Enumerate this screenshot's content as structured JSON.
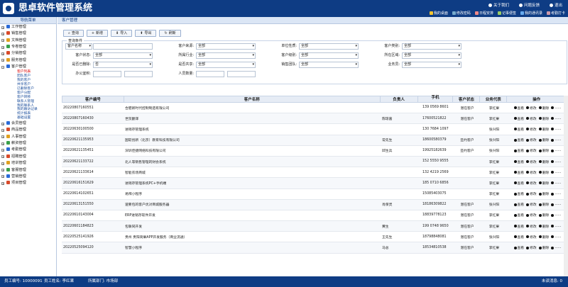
{
  "app": {
    "title": "思卓软件管理系统"
  },
  "sys_menu": [
    "关于我们",
    "问题反馈",
    "退出"
  ],
  "quick_links": [
    "我的桌面",
    "修改密码",
    "日程安排",
    "记事便签",
    "我的通讯录",
    "考勤打卡"
  ],
  "sidebar": {
    "title": "导航菜单",
    "items": [
      {
        "label": "工作管理",
        "color": "#2a6ad8"
      },
      {
        "label": "销售管理",
        "color": "#d84a2a"
      },
      {
        "label": "文档管理",
        "color": "#e0a020"
      },
      {
        "label": "专卷管理",
        "color": "#3aa04a"
      },
      {
        "label": "分销管理",
        "color": "#d84a2a"
      },
      {
        "label": "服务管理",
        "color": "#e0a020"
      },
      {
        "label": "客户管理",
        "color": "#2a6ad8"
      }
    ],
    "sub_items": [
      {
        "label": "客户列表",
        "active": true
      },
      {
        "label": "团队客户"
      },
      {
        "label": "我的客户"
      },
      {
        "label": "共享客户"
      },
      {
        "label": "已删除客户"
      },
      {
        "label": "客户分配"
      },
      {
        "label": "客户转移"
      },
      {
        "label": "联系人管理"
      },
      {
        "label": "我的联系人"
      },
      {
        "label": "我的跟访记录"
      },
      {
        "label": "统计报表"
      },
      {
        "label": "基础设置"
      }
    ],
    "items2": [
      {
        "label": "会员管理",
        "color": "#2a6ad8"
      },
      {
        "label": "商品管理",
        "color": "#d84a2a"
      },
      {
        "label": "人事管理",
        "color": "#e0a020"
      },
      {
        "label": "薪资管理",
        "color": "#3aa04a"
      },
      {
        "label": "考勤管理",
        "color": "#2a6ad8"
      },
      {
        "label": "招聘管理",
        "color": "#d84a2a"
      },
      {
        "label": "培训管理",
        "color": "#e0a020"
      },
      {
        "label": "客服管理",
        "color": "#3aa04a"
      },
      {
        "label": "营销管理",
        "color": "#2a6ad8"
      },
      {
        "label": "项目管理",
        "color": "#d84a2a"
      }
    ]
  },
  "breadcrumb": "客户管理",
  "buttons": [
    "查询",
    "新增",
    "导入",
    "导出",
    "刷新"
  ],
  "filter": {
    "legend": "查询条件",
    "f1": "客户名称",
    "f_status": "客户状态:",
    "f_del": "是否已删除:",
    "f_del_val": "否",
    "f_office": "办公室积:",
    "f_source": "客户来源:",
    "f_industry": "所属行业:",
    "f_share": "是否共享:",
    "f_people": "人员数量:",
    "f_type": "单位性质:",
    "f_level": "客户级别:",
    "f_team": "销售团队:",
    "f_type2": "客户类别:",
    "f_region": "所在区域:",
    "f_sales": "业务员:",
    "all": "全部"
  },
  "table": {
    "headers": [
      "客户编号",
      "客户名称",
      "负责人",
      "手机",
      "客户状态",
      "业务代表",
      "操作"
    ],
    "actions": [
      "查看",
      "修改",
      "删除",
      "......"
    ],
    "rows": [
      {
        "id": "20220807160551",
        "name": "合肥新时代控制制造有限公司",
        "owner": "",
        "phone": "139 0569 8601",
        "status": "潜在客户",
        "rep": "李红果"
      },
      {
        "id": "20220807160430",
        "name": "世贸翻译",
        "owner": "陈琼嘉",
        "phone": "17600521822",
        "status": "潜在客户",
        "rep": "李红果"
      },
      {
        "id": "20220630100500",
        "name": "进销存管理系统",
        "owner": "",
        "phone": "130 7684 1097",
        "status": "",
        "rep": "张兴阳"
      },
      {
        "id": "20220621135953",
        "name": "国软创新（北京）教育科技有限公司",
        "owner": "常先生",
        "phone": "18600580379",
        "status": "签约客户",
        "rep": "张兴阳"
      },
      {
        "id": "20220621135451",
        "name": "深圳佳捷网络科技有限公司",
        "owner": "邱生兵",
        "phone": "19925182639",
        "status": "签约客户",
        "rep": "张兴阳"
      },
      {
        "id": "20220621133722",
        "name": "北人等销售管理的财会系统",
        "owner": "",
        "phone": "152 5550 9555",
        "status": "",
        "rep": "李红果"
      },
      {
        "id": "20220621133614",
        "name": "智能农场商城",
        "owner": "",
        "phone": "132 4219 2569",
        "status": "",
        "rep": "李红果"
      },
      {
        "id": "20220616151629",
        "name": "进销存管理系统PC+手机端",
        "owner": "",
        "phone": "185 0710 6856",
        "status": "",
        "rep": "李红果"
      },
      {
        "id": "20220614102651",
        "name": "易拜小程序",
        "owner": "",
        "phone": "15085403075",
        "status": "",
        "rep": "李红果"
      },
      {
        "id": "20220613151550",
        "name": "速要包的客户优对商城服务器",
        "owner": "肖保灵",
        "phone": "18186309822",
        "status": "潜在客户",
        "rep": "张兴阳"
      },
      {
        "id": "20220610143004",
        "name": "ERP进销存软件开发",
        "owner": "",
        "phone": "18839778123",
        "status": "潜在客户",
        "rep": "李红果"
      },
      {
        "id": "20220601184823",
        "name": "包联同开发",
        "owner": "黄生",
        "phone": "199 0748 9650",
        "status": "潜在客户",
        "rep": "李红果"
      },
      {
        "id": "20220525141926",
        "name": "贵州 贵阳简果APP开发服务（商业流通）",
        "owner": "王先生",
        "phone": "18798848081",
        "status": "潜在客户",
        "rep": "张兴阳"
      },
      {
        "id": "20220525094120",
        "name": "智慧小程序",
        "owner": "马总",
        "phone": "18534810538",
        "status": "潜在客户",
        "rep": "李红果"
      }
    ]
  },
  "footer": {
    "emp_no": "员工编号: 10000091",
    "emp_name": "员工姓名: 李红果",
    "dept": "所属部门: 市场部",
    "msg": "未读消息: 0"
  }
}
